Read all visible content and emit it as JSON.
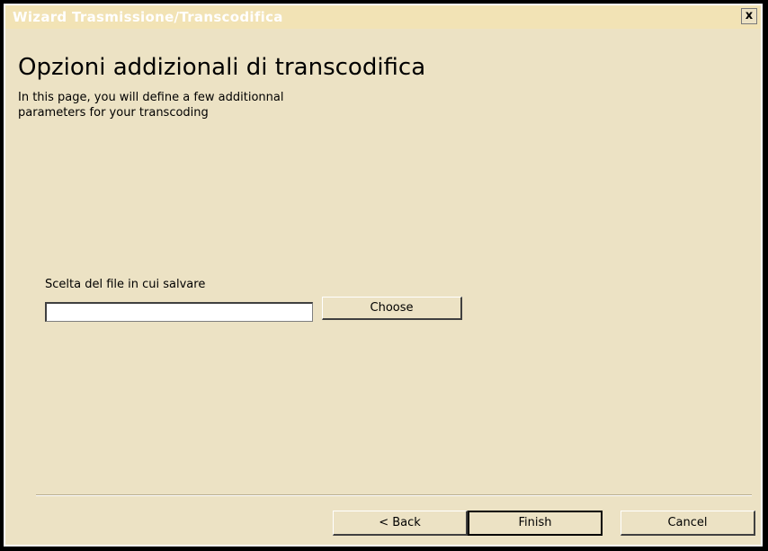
{
  "window": {
    "title": "Wizard Trasmissione/Transcodifica",
    "close_label": "x"
  },
  "page": {
    "heading": "Opzioni addizionali di transcodifica",
    "subtitle": "In this page, you will define a few additionnal\nparameters for your transcoding"
  },
  "file_selection": {
    "label": "Scelta del file in cui salvare",
    "input_value": "",
    "choose_label": "Choose"
  },
  "footer": {
    "back_label": "< Back",
    "finish_label": "Finish",
    "cancel_label": "Cancel"
  },
  "colors": {
    "window_background": "#ECE2C4",
    "titlebar_background": "#F2E3B5",
    "title_text": "#FFFFFF",
    "outer_frame": "#000000"
  },
  "icons": {
    "close": "close-icon"
  }
}
